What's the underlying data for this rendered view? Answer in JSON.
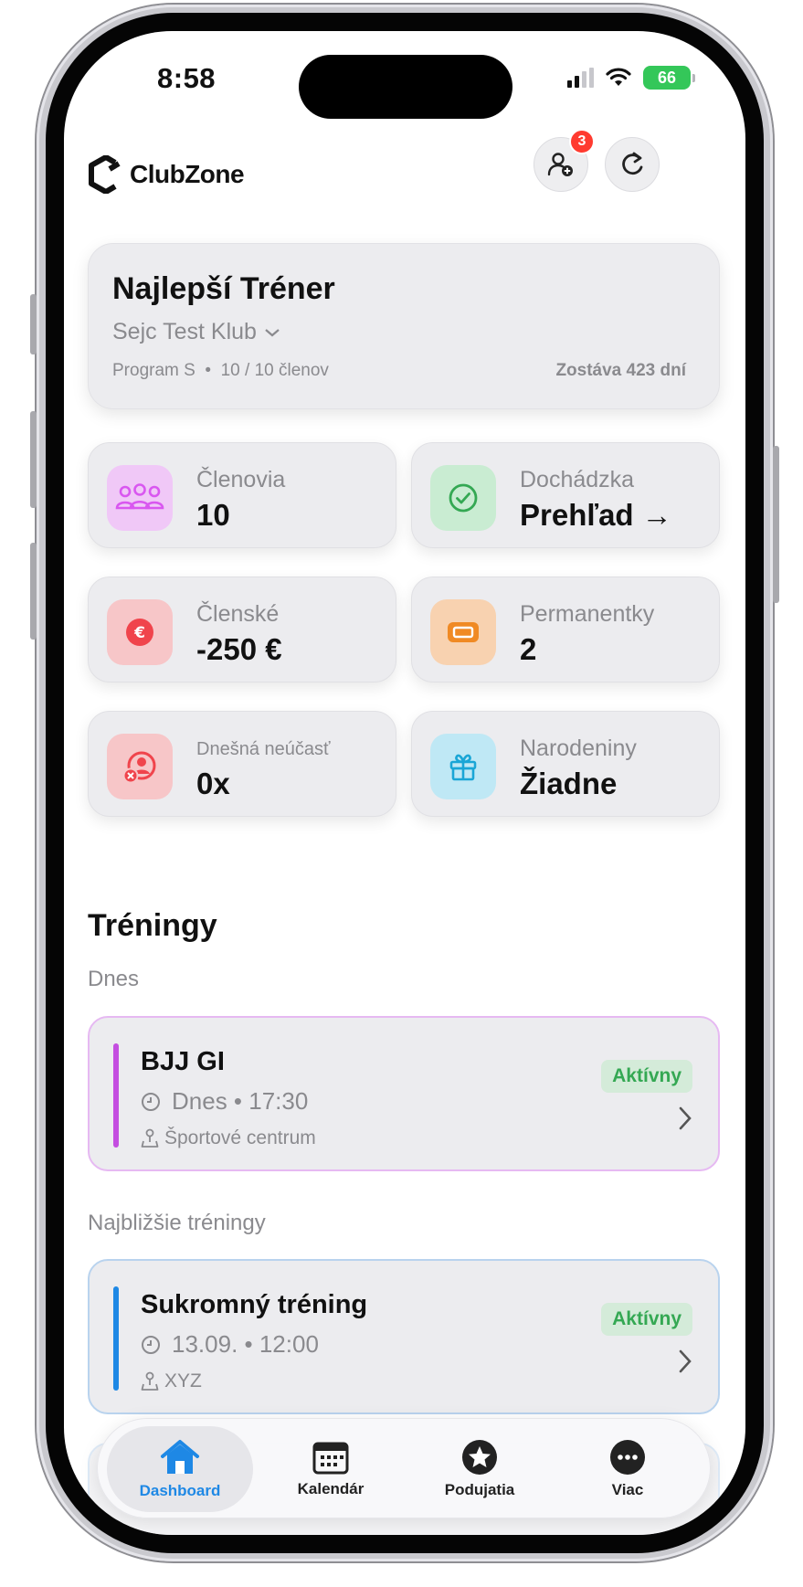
{
  "status_bar": {
    "time": "8:58",
    "battery": "66"
  },
  "header": {
    "app_name": "ClubZone",
    "notification_count": "3"
  },
  "club": {
    "title": "Najlepší Tréner",
    "club_name": "Sejc Test Klub",
    "program": "Program S",
    "members_count": "10 / 10 členov",
    "remaining": "Zostáva 423 dní"
  },
  "stats": [
    {
      "label": "Členovia",
      "value": "10",
      "icon": "members-icon",
      "color": "#d96bf0",
      "bg": "#f0c8f7"
    },
    {
      "label": "Dochádzka",
      "value": "Prehľad →",
      "icon": "check-circle-icon",
      "color": "#34a853",
      "bg": "#c9ecd2"
    },
    {
      "label": "Členské",
      "value": "-250 €",
      "icon": "euro-icon",
      "color": "#f0444c",
      "bg": "#f7c6c8"
    },
    {
      "label": "Permanentky",
      "value": "2",
      "icon": "ticket-icon",
      "color": "#f08a24",
      "bg": "#f8d2b0"
    },
    {
      "label": "Dnešná neúčasť",
      "value": "0x",
      "icon": "absence-icon",
      "color": "#f0444c",
      "bg": "#f7c6c8"
    },
    {
      "label": "Narodeniny",
      "value": "Žiadne",
      "icon": "gift-icon",
      "color": "#1aa6d6",
      "bg": "#bfe8f5"
    }
  ],
  "trainings": {
    "section_title": "Tréningy",
    "today_label": "Dnes",
    "upcoming_label": "Najbližšie tréningy",
    "today": [
      {
        "name": "BJJ GI",
        "time": "Dnes • 17:30",
        "place": "Športové centrum",
        "status": "Aktívny",
        "accent": "#c44ee0",
        "border": "#e6b9f2"
      }
    ],
    "upcoming": [
      {
        "name": "Sukromný tréning",
        "time": "13.09. • 12:00",
        "place": "XYZ",
        "status": "Aktívny",
        "accent": "#1e88e5",
        "border": "#b9d3ee"
      }
    ]
  },
  "tabbar": {
    "tabs": [
      {
        "label": "Dashboard",
        "icon": "home-icon",
        "active": true
      },
      {
        "label": "Kalendár",
        "icon": "calendar-icon",
        "active": false
      },
      {
        "label": "Podujatia",
        "icon": "star-icon",
        "active": false
      },
      {
        "label": "Viac",
        "icon": "more-icon",
        "active": false
      }
    ]
  }
}
